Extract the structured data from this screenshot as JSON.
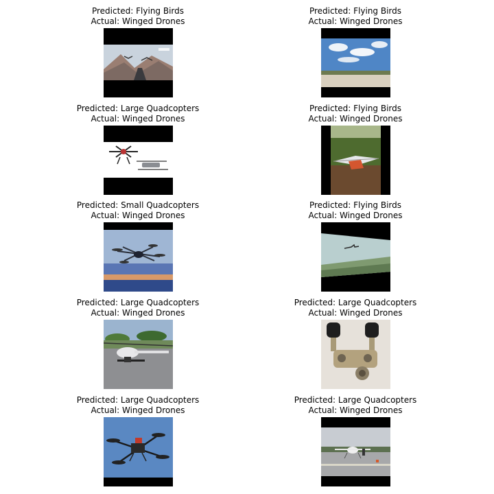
{
  "grid": [
    {
      "predicted": "Predicted: Flying Birds",
      "actual": "Actual: Winged Drones",
      "image": "birds-over-desert-road"
    },
    {
      "predicted": "Predicted: Flying Birds",
      "actual": "Actual: Winged Drones",
      "image": "sky-over-desert-landscape"
    },
    {
      "predicted": "Predicted: Large Quadcopters",
      "actual": "Actual: Winged Drones",
      "image": "two-drones-white-background"
    },
    {
      "predicted": "Predicted: Flying Birds",
      "actual": "Actual: Winged Drones",
      "image": "fixed-wing-drone-on-grass"
    },
    {
      "predicted": "Predicted: Small Quadcopters",
      "actual": "Actual: Winged Drones",
      "image": "hexacopter-in-sky"
    },
    {
      "predicted": "Predicted: Flying Birds",
      "actual": "Actual: Winged Drones",
      "image": "aircraft-in-sky-tilted"
    },
    {
      "predicted": "Predicted: Large Quadcopters",
      "actual": "Actual: Winged Drones",
      "image": "unmanned-helicopter-on-tarmac"
    },
    {
      "predicted": "Predicted: Large Quadcopters",
      "actual": "Actual: Winged Drones",
      "image": "drone-engine-mechanism"
    },
    {
      "predicted": "Predicted: Large Quadcopters",
      "actual": "Actual: Winged Drones",
      "image": "quadcopter-blue-sky"
    },
    {
      "predicted": "Predicted: Large Quadcopters",
      "actual": "Actual: Winged Drones",
      "image": "drone-on-runway"
    }
  ]
}
